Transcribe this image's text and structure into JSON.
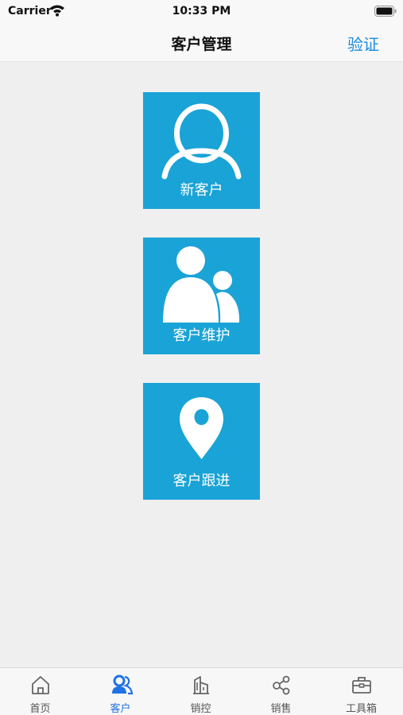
{
  "status": {
    "carrier": "Carrier",
    "time": "10:33 PM"
  },
  "nav": {
    "title": "客户管理",
    "right_action": "验证"
  },
  "tiles": [
    {
      "label": "新客户",
      "icon": "person-outline-icon"
    },
    {
      "label": "客户维护",
      "icon": "people-icon"
    },
    {
      "label": "客户跟进",
      "icon": "map-pin-icon"
    }
  ],
  "tabs": [
    {
      "label": "首页",
      "icon": "home-icon",
      "active": false
    },
    {
      "label": "客户",
      "icon": "users-icon",
      "active": true
    },
    {
      "label": "销控",
      "icon": "building-icon",
      "active": false
    },
    {
      "label": "销售",
      "icon": "share-icon",
      "active": false
    },
    {
      "label": "工具箱",
      "icon": "toolbox-icon",
      "active": false
    }
  ],
  "colors": {
    "accent": "#1a8be0",
    "tile": "#1aa3d6",
    "tab_active": "#1f72e6"
  }
}
